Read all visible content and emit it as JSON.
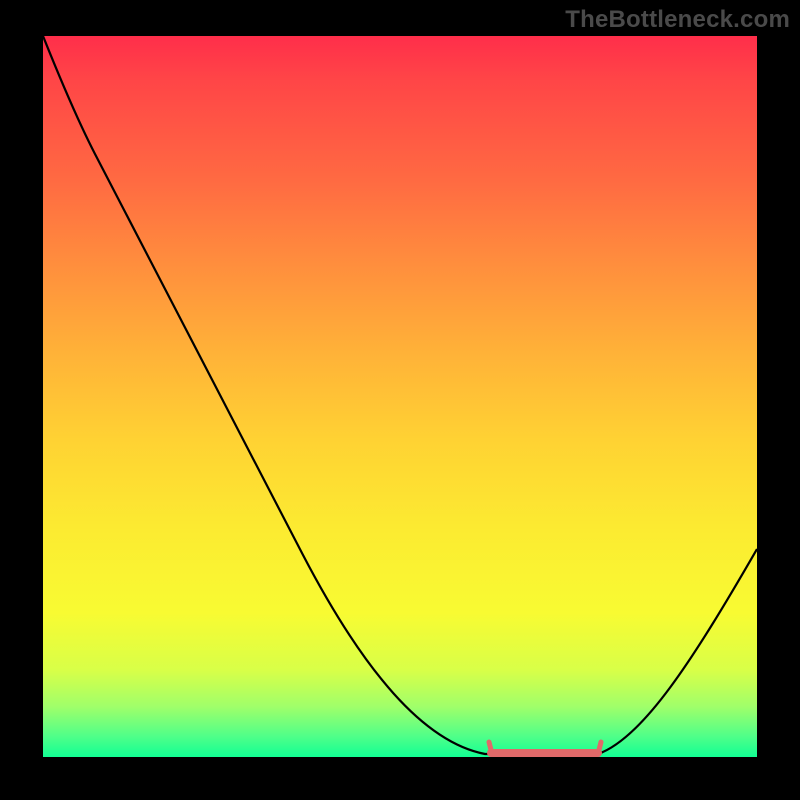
{
  "watermark": "TheBottleneck.com",
  "chart_data": {
    "type": "line",
    "title": "",
    "xlabel": "",
    "ylabel": "",
    "xlim": [
      0,
      100
    ],
    "ylim": [
      0,
      100
    ],
    "x": [
      0,
      5,
      10,
      15,
      20,
      25,
      30,
      35,
      40,
      45,
      50,
      55,
      60,
      63,
      66,
      70,
      74,
      78,
      82,
      86,
      90,
      95,
      100
    ],
    "y": [
      100,
      94,
      85,
      76,
      67,
      58,
      49,
      40,
      31,
      23,
      15,
      9,
      4,
      1,
      0,
      0,
      0,
      1,
      4,
      9,
      14,
      21,
      29
    ],
    "optimal_band": {
      "x_start": 63,
      "x_end": 78,
      "y": 0
    },
    "background_gradient": {
      "type": "rainbow-vertical",
      "stops": [
        {
          "pos": 0.0,
          "color": "#ff2e4a"
        },
        {
          "pos": 0.32,
          "color": "#ff8f3d"
        },
        {
          "pos": 0.68,
          "color": "#fcea31"
        },
        {
          "pos": 0.93,
          "color": "#a0ff6a"
        },
        {
          "pos": 1.0,
          "color": "#12ff94"
        }
      ]
    }
  }
}
